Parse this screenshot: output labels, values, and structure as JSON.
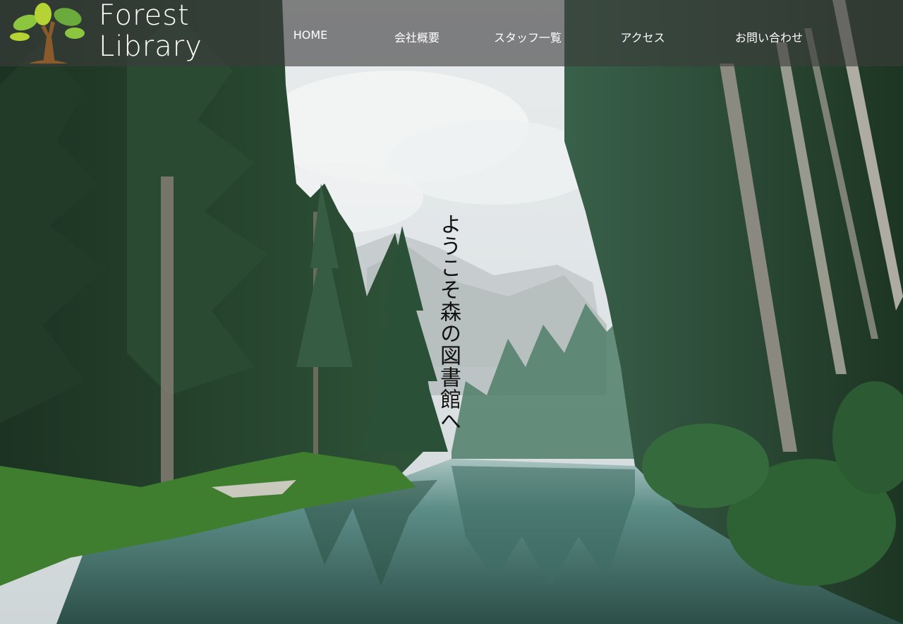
{
  "site": {
    "logo_line1": "Forest",
    "logo_line2": "Library"
  },
  "nav": {
    "home": "HOME",
    "company": "会社概要",
    "staff": "スタッフ一覧",
    "access": "アクセス",
    "contact": "お問い合わせ"
  },
  "hero": {
    "welcome": "ようこそ森の図書館へ",
    "image": "forest-lake-landscape"
  },
  "colors": {
    "header_bg": "rgba(60,60,60,0.62)",
    "text_light": "#ffffff",
    "leaf_green": "#8cc63f",
    "trunk_brown": "#8b5a2b"
  }
}
